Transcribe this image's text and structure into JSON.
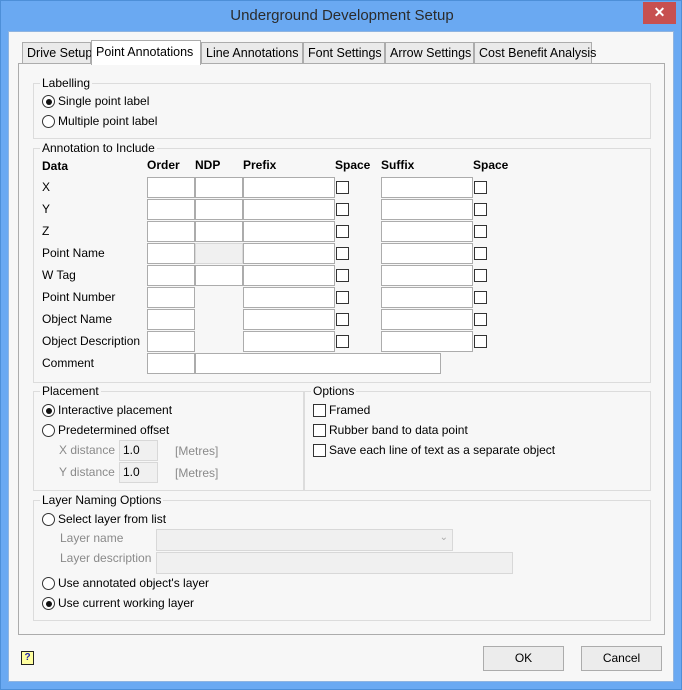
{
  "window": {
    "title": "Underground Development Setup",
    "close_glyph": "✕"
  },
  "tabs": [
    "Drive Setup",
    "Point Annotations",
    "Line Annotations",
    "Font Settings",
    "Arrow Settings",
    "Cost Benefit Analysis"
  ],
  "labelling": {
    "title": "Labelling",
    "options": [
      "Single point label",
      "Multiple point label"
    ],
    "selected": 0
  },
  "annotation": {
    "title": "Annotation to Include",
    "headers": {
      "data": "Data",
      "order": "Order",
      "ndp": "NDP",
      "prefix": "Prefix",
      "space1": "Space",
      "suffix": "Suffix",
      "space2": "Space"
    },
    "rows": [
      {
        "label": "X",
        "ndp": "enabled",
        "has_prefix": true
      },
      {
        "label": "Y",
        "ndp": "enabled",
        "has_prefix": true
      },
      {
        "label": "Z",
        "ndp": "enabled",
        "has_prefix": true
      },
      {
        "label": "Point Name",
        "ndp": "disabled",
        "has_prefix": true
      },
      {
        "label": "W Tag",
        "ndp": "enabled",
        "has_prefix": true
      },
      {
        "label": "Point Number",
        "ndp": "none",
        "has_prefix": true
      },
      {
        "label": "Object Name",
        "ndp": "none",
        "has_prefix": true
      },
      {
        "label": "Object Description",
        "ndp": "none",
        "has_prefix": true
      },
      {
        "label": "Comment",
        "ndp": "comment",
        "has_prefix": false
      }
    ]
  },
  "placement": {
    "title": "Placement",
    "options": [
      "Interactive placement",
      "Predetermined offset"
    ],
    "selected": 0,
    "x_label": "X distance",
    "x_value": "1.0",
    "y_label": "Y distance",
    "y_value": "1.0",
    "unit": "[Metres]"
  },
  "options": {
    "title": "Options",
    "items": [
      "Framed",
      "Rubber band to data point",
      "Save each line of text as a separate object"
    ]
  },
  "layer": {
    "title": "Layer Naming Options",
    "opt_list": "Select layer from list",
    "layer_name_label": "Layer name",
    "layer_desc_label": "Layer description",
    "opt_annotated": "Use annotated object's layer",
    "opt_current": "Use current working layer",
    "selected": "current"
  },
  "footer": {
    "ok": "OK",
    "cancel": "Cancel",
    "help_glyph": "?"
  }
}
